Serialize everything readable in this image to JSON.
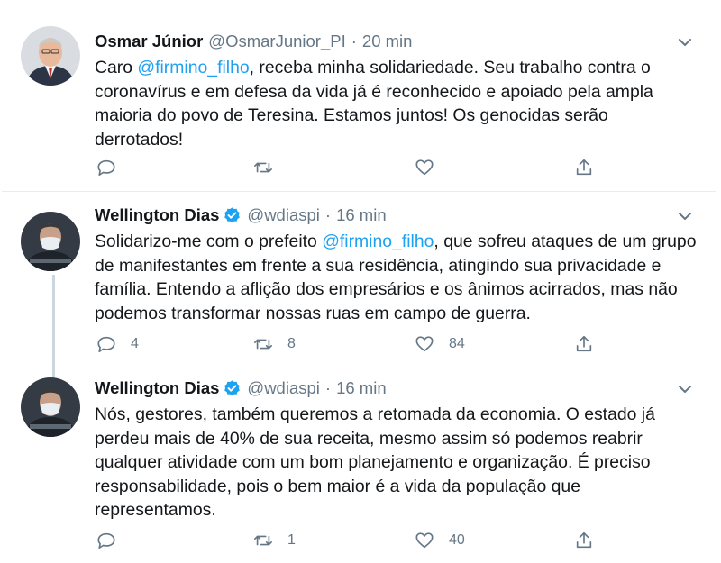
{
  "colors": {
    "accent": "#1da1f2",
    "secondary_text": "#657786",
    "primary_text": "#14171a",
    "divider": "#e6ecf0"
  },
  "tweets": [
    {
      "author": {
        "name": "Osmar Júnior",
        "handle": "@OsmarJunior_PI",
        "verified": false
      },
      "time": "20 min",
      "text_parts": [
        {
          "t": "Caro "
        },
        {
          "t": "@firmino_filho",
          "mention": true
        },
        {
          "t": ", receba minha solidariedade. Seu trabalho contra o coronavírus e em defesa da vida já é reconhecido e apoiado pela ampla maioria do povo de Teresina. Estamos juntos! Os genocidas serão derrotados!"
        }
      ],
      "counts": {
        "reply": "",
        "retweet": "",
        "like": ""
      }
    },
    {
      "author": {
        "name": "Wellington Dias",
        "handle": "@wdiaspi",
        "verified": true
      },
      "time": "16 min",
      "text_parts": [
        {
          "t": "Solidarizo-me com o prefeito "
        },
        {
          "t": "@firmino_filho",
          "mention": true
        },
        {
          "t": ", que sofreu ataques de um grupo de manifestantes em frente a sua residência, atingindo sua privacidade e família. Entendo a aflição dos empresários e os ânimos acirrados, mas não podemos transformar nossas ruas em campo de guerra."
        }
      ],
      "counts": {
        "reply": "4",
        "retweet": "8",
        "like": "84"
      }
    },
    {
      "author": {
        "name": "Wellington Dias",
        "handle": "@wdiaspi",
        "verified": true
      },
      "time": "16 min",
      "text_parts": [
        {
          "t": "Nós, gestores, também queremos a retomada da economia. O estado já perdeu mais de 40% de sua receita, mesmo assim só podemos reabrir qualquer atividade com um bom planejamento e organização. É preciso responsabilidade, pois o bem maior é a vida da população que representamos."
        }
      ],
      "counts": {
        "reply": "",
        "retweet": "1",
        "like": "40"
      }
    }
  ],
  "icons": {
    "reply": "reply-icon",
    "retweet": "retweet-icon",
    "like": "heart-icon",
    "share": "share-icon",
    "menu": "chevron-down-icon",
    "verified": "verified-badge-icon"
  },
  "separator": "·"
}
